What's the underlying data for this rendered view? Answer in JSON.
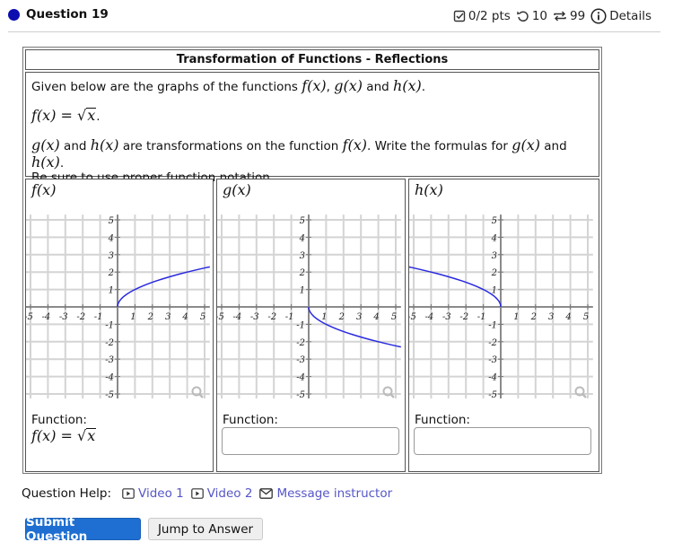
{
  "header": {
    "question_title": "Question 19",
    "points": "0/2 pts",
    "retries": "10",
    "attempts": "99",
    "details_label": "Details",
    "dot_color": "#0d0db0"
  },
  "problem": {
    "title": "Transformation of Functions - Reflections",
    "intro_prefix": "Given below are the graphs of the functions ",
    "f_notation": "f(x)",
    "g_notation": "g(x)",
    "h_notation": "h(x)",
    "comma": ", ",
    "and": " and ",
    "period": ".",
    "f_def_lhs": "f(x) = ",
    "f_def_rad": "x",
    "instr_1": " and ",
    "instr_2": " are transformations on the function ",
    "instr_3": ". Write the formulas for ",
    "instr_4": " and ",
    "instr_5": ".",
    "instr_line2": "Be sure to use proper function notation."
  },
  "graphs": [
    {
      "label": "f(x)",
      "function_label": "Function:",
      "function_value_lhs": "f(x) = ",
      "function_value_rad": "x",
      "curve": "sqrt(x)",
      "input_value": null
    },
    {
      "label": "g(x)",
      "function_label": "Function:",
      "function_value_lhs": null,
      "curve": "-sqrt(x)",
      "input_value": ""
    },
    {
      "label": "h(x)",
      "function_label": "Function:",
      "function_value_lhs": null,
      "curve": "sqrt(-x)",
      "input_value": ""
    }
  ],
  "chart_data": [
    {
      "type": "line",
      "title": "f(x)",
      "xlim": [
        -5,
        5
      ],
      "ylim": [
        -5,
        5
      ],
      "grid": true,
      "xticks": [
        -5,
        -4,
        -3,
        -2,
        -1,
        1,
        2,
        3,
        4,
        5
      ],
      "yticks": [
        -5,
        -4,
        -3,
        -2,
        -1,
        1,
        2,
        3,
        4,
        5
      ],
      "series": [
        {
          "name": "f(x)",
          "formula": "sqrt(x)",
          "x": [
            0,
            0.25,
            1,
            2,
            3,
            4,
            5
          ],
          "y": [
            0,
            0.5,
            1,
            1.41,
            1.73,
            2,
            2.24
          ]
        }
      ]
    },
    {
      "type": "line",
      "title": "g(x)",
      "xlim": [
        -5,
        5
      ],
      "ylim": [
        -5,
        5
      ],
      "grid": true,
      "xticks": [
        -5,
        -4,
        -3,
        -2,
        -1,
        1,
        2,
        3,
        4,
        5
      ],
      "yticks": [
        -5,
        -4,
        -3,
        -2,
        -1,
        1,
        2,
        3,
        4,
        5
      ],
      "series": [
        {
          "name": "g(x)",
          "formula": "-sqrt(x)",
          "x": [
            0,
            0.25,
            1,
            2,
            3,
            4,
            5
          ],
          "y": [
            0,
            -0.5,
            -1,
            -1.41,
            -1.73,
            -2,
            -2.24
          ]
        }
      ]
    },
    {
      "type": "line",
      "title": "h(x)",
      "xlim": [
        -5,
        5
      ],
      "ylim": [
        -5,
        5
      ],
      "grid": true,
      "xticks": [
        -5,
        -4,
        -3,
        -2,
        -1,
        1,
        2,
        3,
        4,
        5
      ],
      "yticks": [
        -5,
        -4,
        -3,
        -2,
        -1,
        1,
        2,
        3,
        4,
        5
      ],
      "series": [
        {
          "name": "h(x)",
          "formula": "sqrt(-x)",
          "x": [
            0,
            -0.25,
            -1,
            -2,
            -3,
            -4,
            -5
          ],
          "y": [
            0,
            0.5,
            1,
            1.41,
            1.73,
            2,
            2.24
          ]
        }
      ]
    }
  ],
  "curve_color": "#2a2ae0",
  "help": {
    "label": "Question Help:",
    "video1": "Video 1",
    "video2": "Video 2",
    "message": "Message instructor"
  },
  "buttons": {
    "submit": "Submit Question",
    "jump": "Jump to Answer"
  }
}
